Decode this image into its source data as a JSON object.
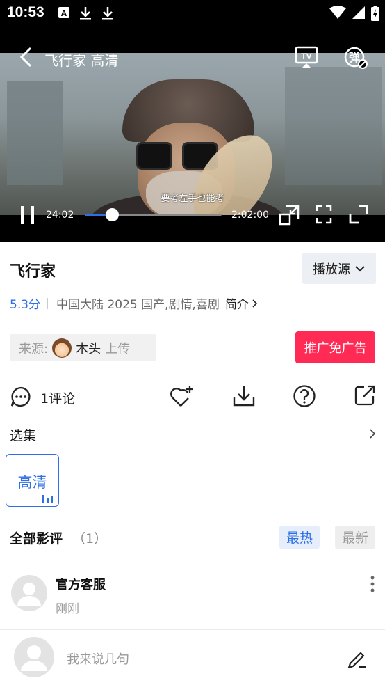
{
  "status_bar": {
    "time": "10:53",
    "icons": [
      "font-icon",
      "download-icon",
      "download-icon",
      "wifi-icon",
      "signal-icon",
      "battery-charging-icon"
    ]
  },
  "player": {
    "title": "飞行家 高清",
    "subtitle": "要考左手也能考",
    "current_time": "24:02",
    "total_time": "2:02:00",
    "progress": 0.196,
    "tv_label": "TV",
    "danmu_label": "弹"
  },
  "info": {
    "title": "飞行家",
    "source_select": "播放源",
    "score": "5.3分",
    "details": "中国大陆  2025  国产,剧情,喜剧",
    "intro": "简介"
  },
  "uploader": {
    "label": "来源:",
    "name": "木头",
    "action": "上传"
  },
  "ad_button": "推广免广告",
  "actions": {
    "comment_count": "1评论"
  },
  "episodes": {
    "label": "选集",
    "items": [
      {
        "label": "高清"
      }
    ]
  },
  "reviews": {
    "label": "全部影评",
    "count": "（1）",
    "sort_hot": "最热",
    "sort_new": "最新",
    "items": [
      {
        "name": "官方客服",
        "time": "刚刚"
      }
    ]
  },
  "bottom": {
    "placeholder": "我来说几句"
  },
  "colors": {
    "accent": "#2e6fe6",
    "ad_button": "#ff2b55"
  }
}
